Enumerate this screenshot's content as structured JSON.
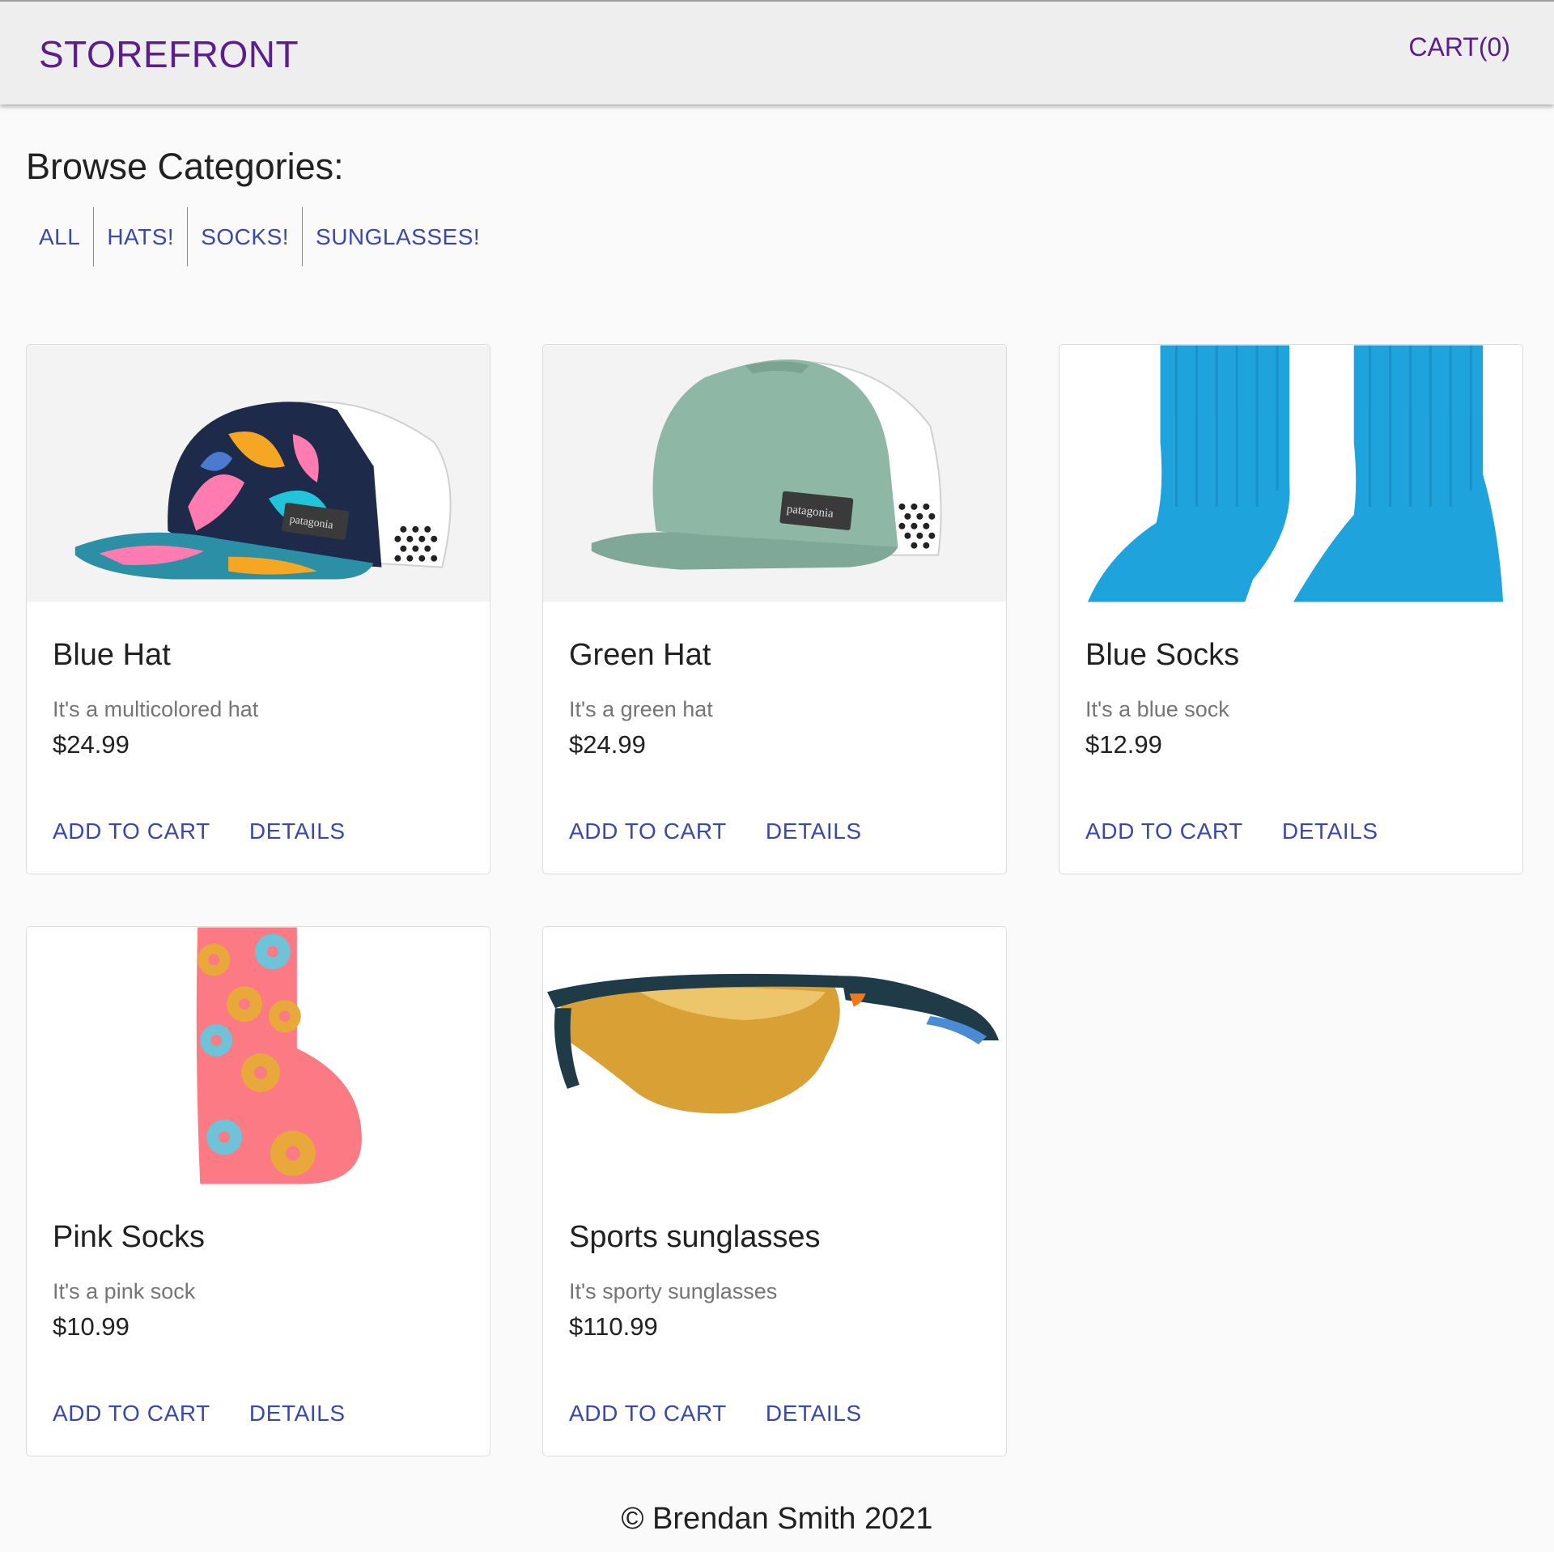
{
  "header": {
    "brand": "STOREFRONT",
    "cart_label": "CART(0)"
  },
  "categories": {
    "title": "Browse Categories:",
    "items": [
      "ALL",
      "HATS!",
      "SOCKS!",
      "SUNGLASSES!"
    ]
  },
  "products": [
    {
      "name": "Blue Hat",
      "description": "It's a multicolored hat",
      "price": "$24.99",
      "image_icon": "multicolor-cap-icon"
    },
    {
      "name": "Green Hat",
      "description": "It's a green hat",
      "price": "$24.99",
      "image_icon": "green-cap-icon"
    },
    {
      "name": "Blue Socks",
      "description": "It's a blue sock",
      "price": "$12.99",
      "image_icon": "blue-socks-icon"
    },
    {
      "name": "Pink Socks",
      "description": "It's a pink sock",
      "price": "$10.99",
      "image_icon": "donut-sock-icon"
    },
    {
      "name": "Sports sunglasses",
      "description": "It's sporty sunglasses",
      "price": "$110.99",
      "image_icon": "sunglasses-icon"
    }
  ],
  "card_actions": {
    "add_to_cart": "ADD TO CART",
    "details": "DETAILS"
  },
  "footer": {
    "copyright": "© Brendan Smith 2021"
  },
  "colors": {
    "brand": "#5b1e8c",
    "link": "#3949ab",
    "header_bg": "#eeeeee",
    "page_bg": "#fafafa"
  }
}
